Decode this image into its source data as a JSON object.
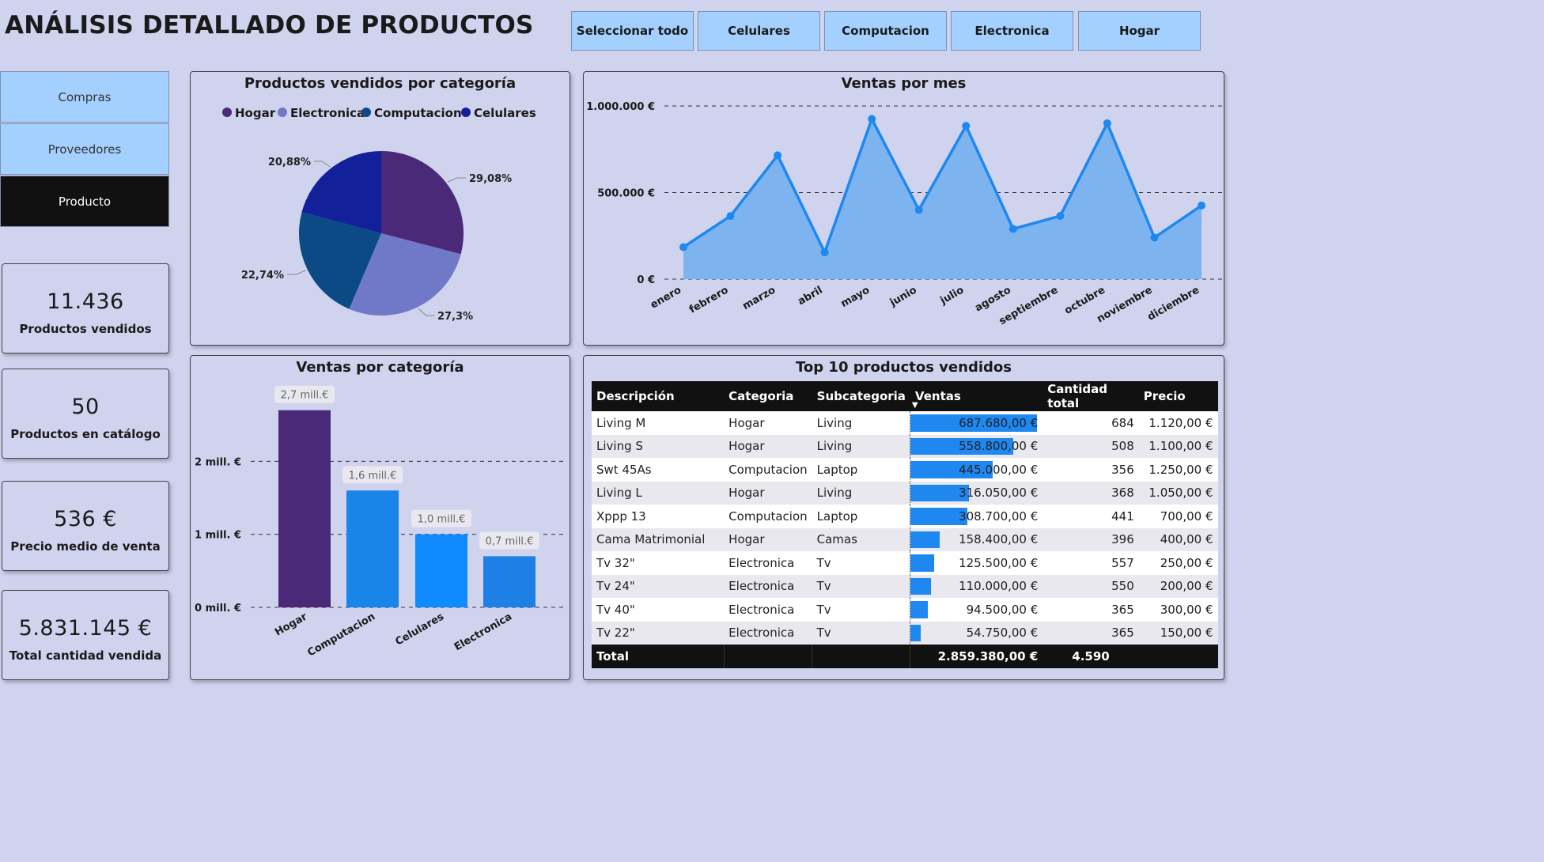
{
  "header": {
    "title": "ANÁLISIS DETALLADO DE PRODUCTOS"
  },
  "filters": [
    "Seleccionar todo",
    "Celulares",
    "Computacion",
    "Electronica",
    "Hogar"
  ],
  "nav": {
    "items": [
      "Compras",
      "Proveedores",
      "Producto"
    ],
    "active_index": 2
  },
  "kpis": [
    {
      "value": "11.436",
      "label": "Productos vendidos"
    },
    {
      "value": "50",
      "label": "Productos en catálogo"
    },
    {
      "value": "536 €",
      "label": "Precio medio de venta"
    },
    {
      "value": "5.831.145 €",
      "label": "Total cantidad vendida"
    }
  ],
  "colors": {
    "background": "#cfd3ee",
    "hogar": "#4a2a78",
    "electronica": "#7079c7",
    "computacion": "#0b4a84",
    "celulares": "#12209a",
    "line": "#1e88f0",
    "area": "#7db4ef"
  },
  "chart_data": [
    {
      "type": "pie",
      "title": "Productos vendidos por categoría",
      "legend": [
        "Hogar",
        "Electronica",
        "Computacion",
        "Celulares"
      ],
      "slices": [
        {
          "name": "Hogar",
          "value": 29.08,
          "label": "29,08%",
          "color": "#4a2a78"
        },
        {
          "name": "Electronica",
          "value": 27.3,
          "label": "27,3%",
          "color": "#7079c7"
        },
        {
          "name": "Computacion",
          "value": 22.74,
          "label": "22,74%",
          "color": "#0b4a84"
        },
        {
          "name": "Celulares",
          "value": 20.88,
          "label": "20,88%",
          "color": "#12209a"
        }
      ],
      "legend_position": "top"
    },
    {
      "type": "area",
      "title": "Ventas por mes",
      "categories": [
        "enero",
        "febrero",
        "marzo",
        "abril",
        "mayo",
        "junio",
        "julio",
        "agosto",
        "septiembre",
        "octubre",
        "noviembre",
        "diciembre"
      ],
      "values": [
        185000,
        365000,
        715000,
        155000,
        925000,
        400000,
        885000,
        290000,
        365000,
        900000,
        240000,
        425000
      ],
      "yticks": [
        "0 €",
        "500.000 €",
        "1.000.000 €"
      ],
      "ylim": [
        0,
        1000000
      ],
      "grid": true
    },
    {
      "type": "bar",
      "title": "Ventas por categoría",
      "categories": [
        "Hogar",
        "Computacion",
        "Celulares",
        "Electronica"
      ],
      "values": [
        2.7,
        1.6,
        1.0,
        0.7
      ],
      "data_labels": [
        "2,7 mill.€",
        "1,6 mill.€",
        "1,0 mill.€",
        "0,7 mill.€"
      ],
      "colors": [
        "#4a2a78",
        "#1984ea",
        "#0f8bff",
        "#1e7fe6"
      ],
      "yticks": [
        "0 mill. €",
        "1 mill. €",
        "2 mill. €"
      ],
      "ylim": [
        0,
        3
      ],
      "grid": true
    },
    {
      "type": "table",
      "title": "Top 10 productos vendidos",
      "columns": [
        "Descripción",
        "Categoria",
        "Subcategoria",
        "Ventas",
        "Cantidad total",
        "Precio"
      ],
      "rows": [
        [
          "Living M",
          "Hogar",
          "Living",
          "687.680,00 €",
          "684",
          "1.120,00 €"
        ],
        [
          "Living S",
          "Hogar",
          "Living",
          "558.800,00 €",
          "508",
          "1.100,00 €"
        ],
        [
          "Swt 45As",
          "Computacion",
          "Laptop",
          "445.000,00 €",
          "356",
          "1.250,00 €"
        ],
        [
          "Living L",
          "Hogar",
          "Living",
          "316.050,00 €",
          "368",
          "1.050,00 €"
        ],
        [
          "Xppp 13",
          "Computacion",
          "Laptop",
          "308.700,00 €",
          "441",
          "700,00 €"
        ],
        [
          "Cama Matrimonial",
          "Hogar",
          "Camas",
          "158.400,00 €",
          "396",
          "400,00 €"
        ],
        [
          "Tv 32\"",
          "Electronica",
          "Tv",
          "125.500,00 €",
          "557",
          "250,00 €"
        ],
        [
          "Tv 24\"",
          "Electronica",
          "Tv",
          "110.000,00 €",
          "550",
          "200,00 €"
        ],
        [
          "Tv 40\"",
          "Electronica",
          "Tv",
          "94.500,00 €",
          "365",
          "300,00 €"
        ],
        [
          "Tv 22\"",
          "Electronica",
          "Tv",
          "54.750,00 €",
          "365",
          "150,00 €"
        ]
      ],
      "ventas_values": [
        687680,
        558800,
        445000,
        316050,
        308700,
        158400,
        125500,
        110000,
        94500,
        54750
      ],
      "total": [
        "Total",
        "",
        "",
        "2.859.380,00 €",
        "4.590",
        ""
      ]
    }
  ]
}
